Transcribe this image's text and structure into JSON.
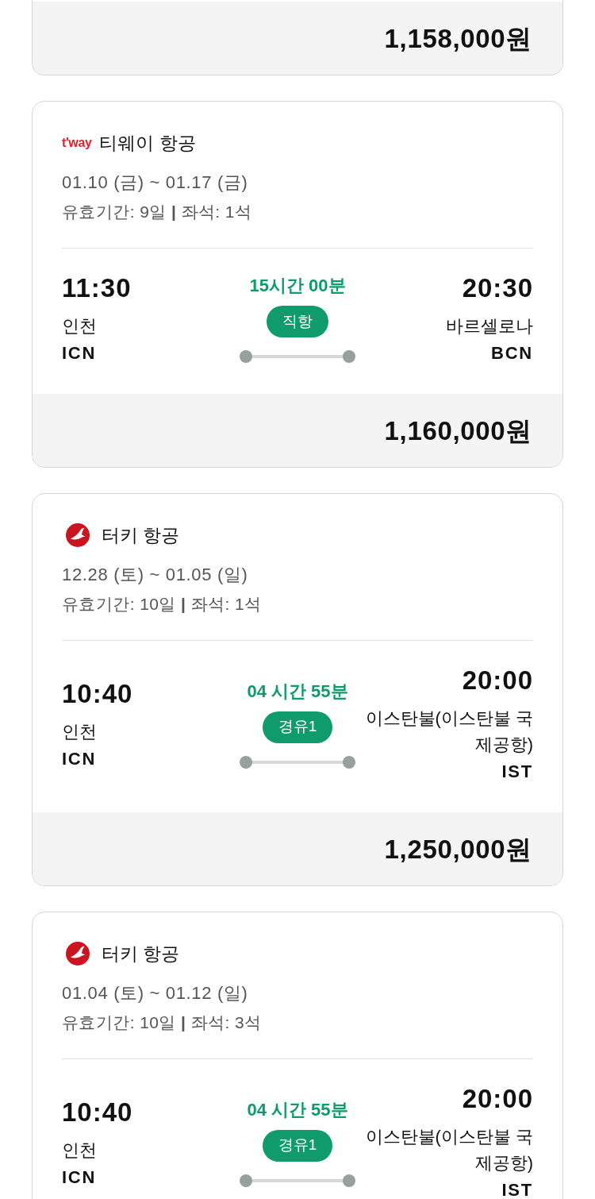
{
  "cards": [
    {
      "kind": "price_only",
      "price": "1,158,000원"
    },
    {
      "kind": "flight",
      "airline": {
        "logo": {
          "kind": "wordmark",
          "text": "t'way"
        },
        "name": "티웨이 항공"
      },
      "dates": "01.10 (금) ~ 01.17 (금)",
      "validity": "유효기간: 9일 **|** 좌석: 1석",
      "departure": {
        "time": "11:30",
        "city": "인천",
        "code": "ICN"
      },
      "duration": "15시간 00분",
      "stops": "직항",
      "arrival": {
        "time": "20:30",
        "city": "바르셀로나",
        "code": "BCN"
      },
      "price": "1,160,000원"
    },
    {
      "kind": "flight",
      "airline": {
        "logo": {
          "kind": "emblem"
        },
        "name": "터키 항공"
      },
      "dates": "12.28 (토) ~ 01.05 (일)",
      "validity": "유효기간: 10일 **|** 좌석: 1석",
      "departure": {
        "time": "10:40",
        "city": "인천",
        "code": "ICN"
      },
      "duration": "04 시간 55분",
      "stops": "경유1",
      "arrival": {
        "time": "20:00",
        "city": "이스탄불(이스탄불 국제공항)",
        "code": "IST"
      },
      "price": "1,250,000원"
    },
    {
      "kind": "flight",
      "airline": {
        "logo": {
          "kind": "emblem"
        },
        "name": "터키 항공"
      },
      "dates": "01.04 (토) ~ 01.12 (일)",
      "validity": "유효기간: 10일 **|** 좌석: 3석",
      "departure": {
        "time": "10:40",
        "city": "인천",
        "code": "ICN"
      },
      "duration": "04 시간 55분",
      "stops": "경유1",
      "arrival": {
        "time": "20:00",
        "city": "이스탄불(이스탄불 국제공항)",
        "code": "IST"
      }
    }
  ]
}
